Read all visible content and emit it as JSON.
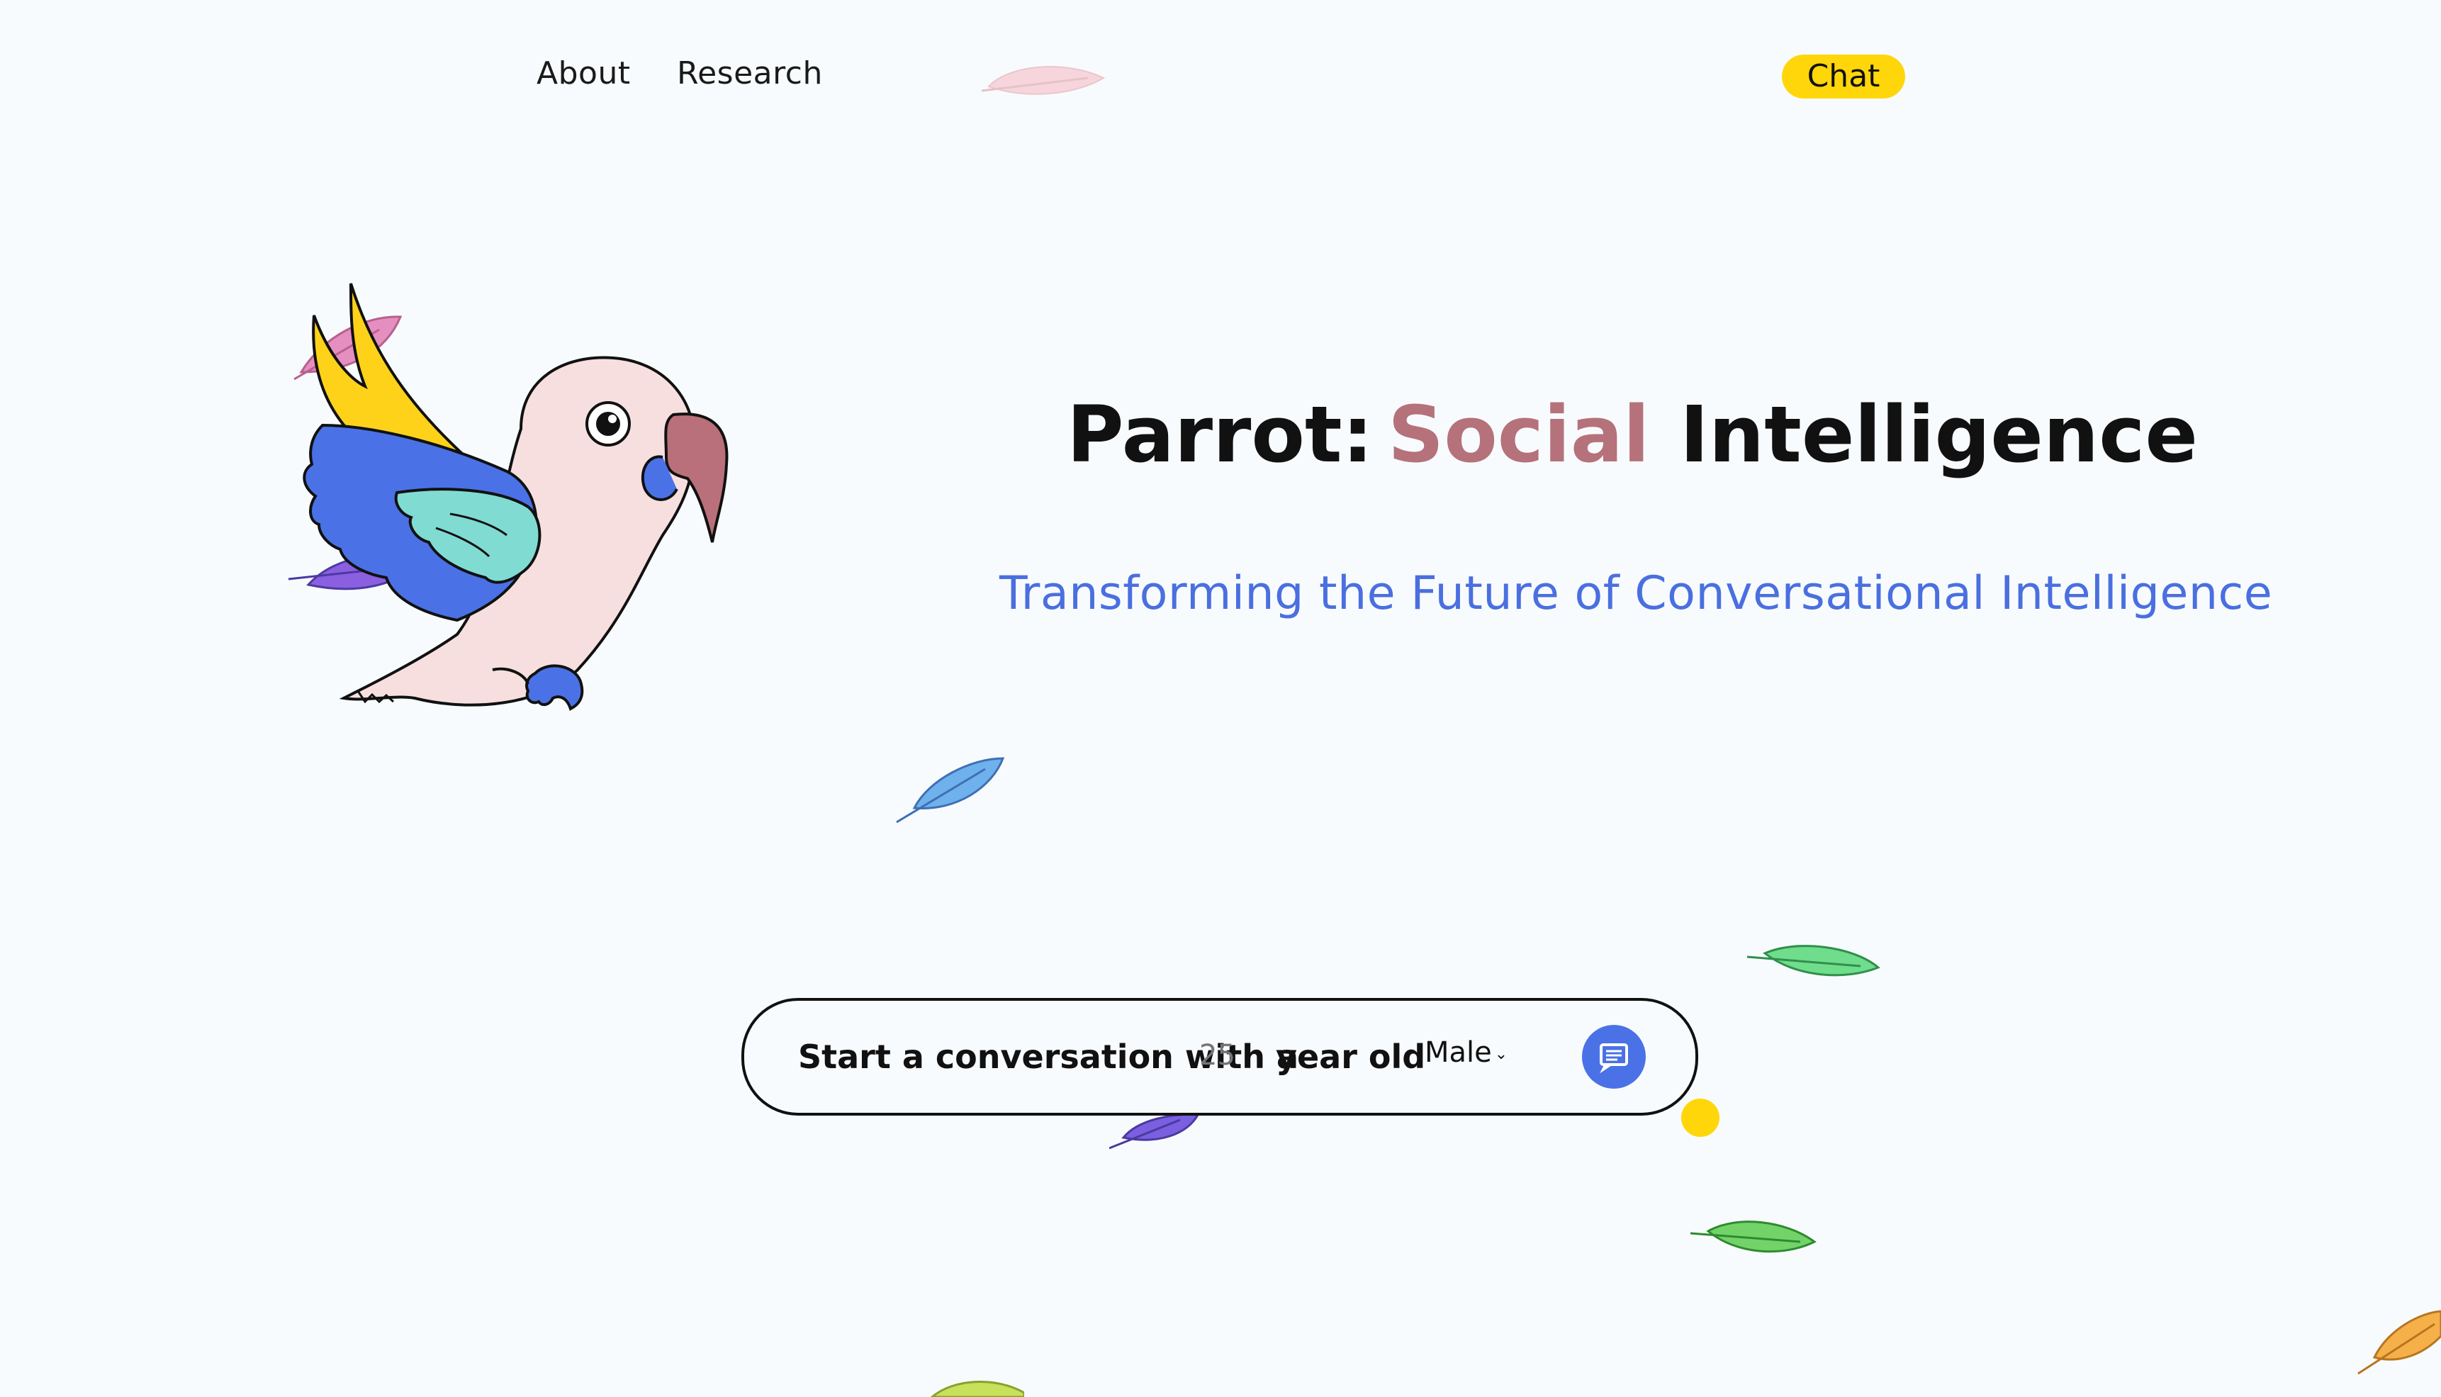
{
  "nav": {
    "about": "About",
    "research": "Research",
    "chat": "Chat"
  },
  "hero": {
    "title_word_1": "Parrot:",
    "title_word_2": "Social",
    "title_word_3": "Intelligence",
    "subtitle": "Transforming the Future of Conversational Intelligence"
  },
  "conversation": {
    "prefix": "Start a conversation with a",
    "age_value": "25",
    "age_placeholder": "25",
    "middle": "year old",
    "gender_value": "Male",
    "send_icon": "message-icon"
  },
  "colors": {
    "background": "#f8fbfd",
    "accent_yellow": "#ffd60a",
    "accent_blue": "#4a72e6",
    "title_highlight": "#b5727a"
  }
}
